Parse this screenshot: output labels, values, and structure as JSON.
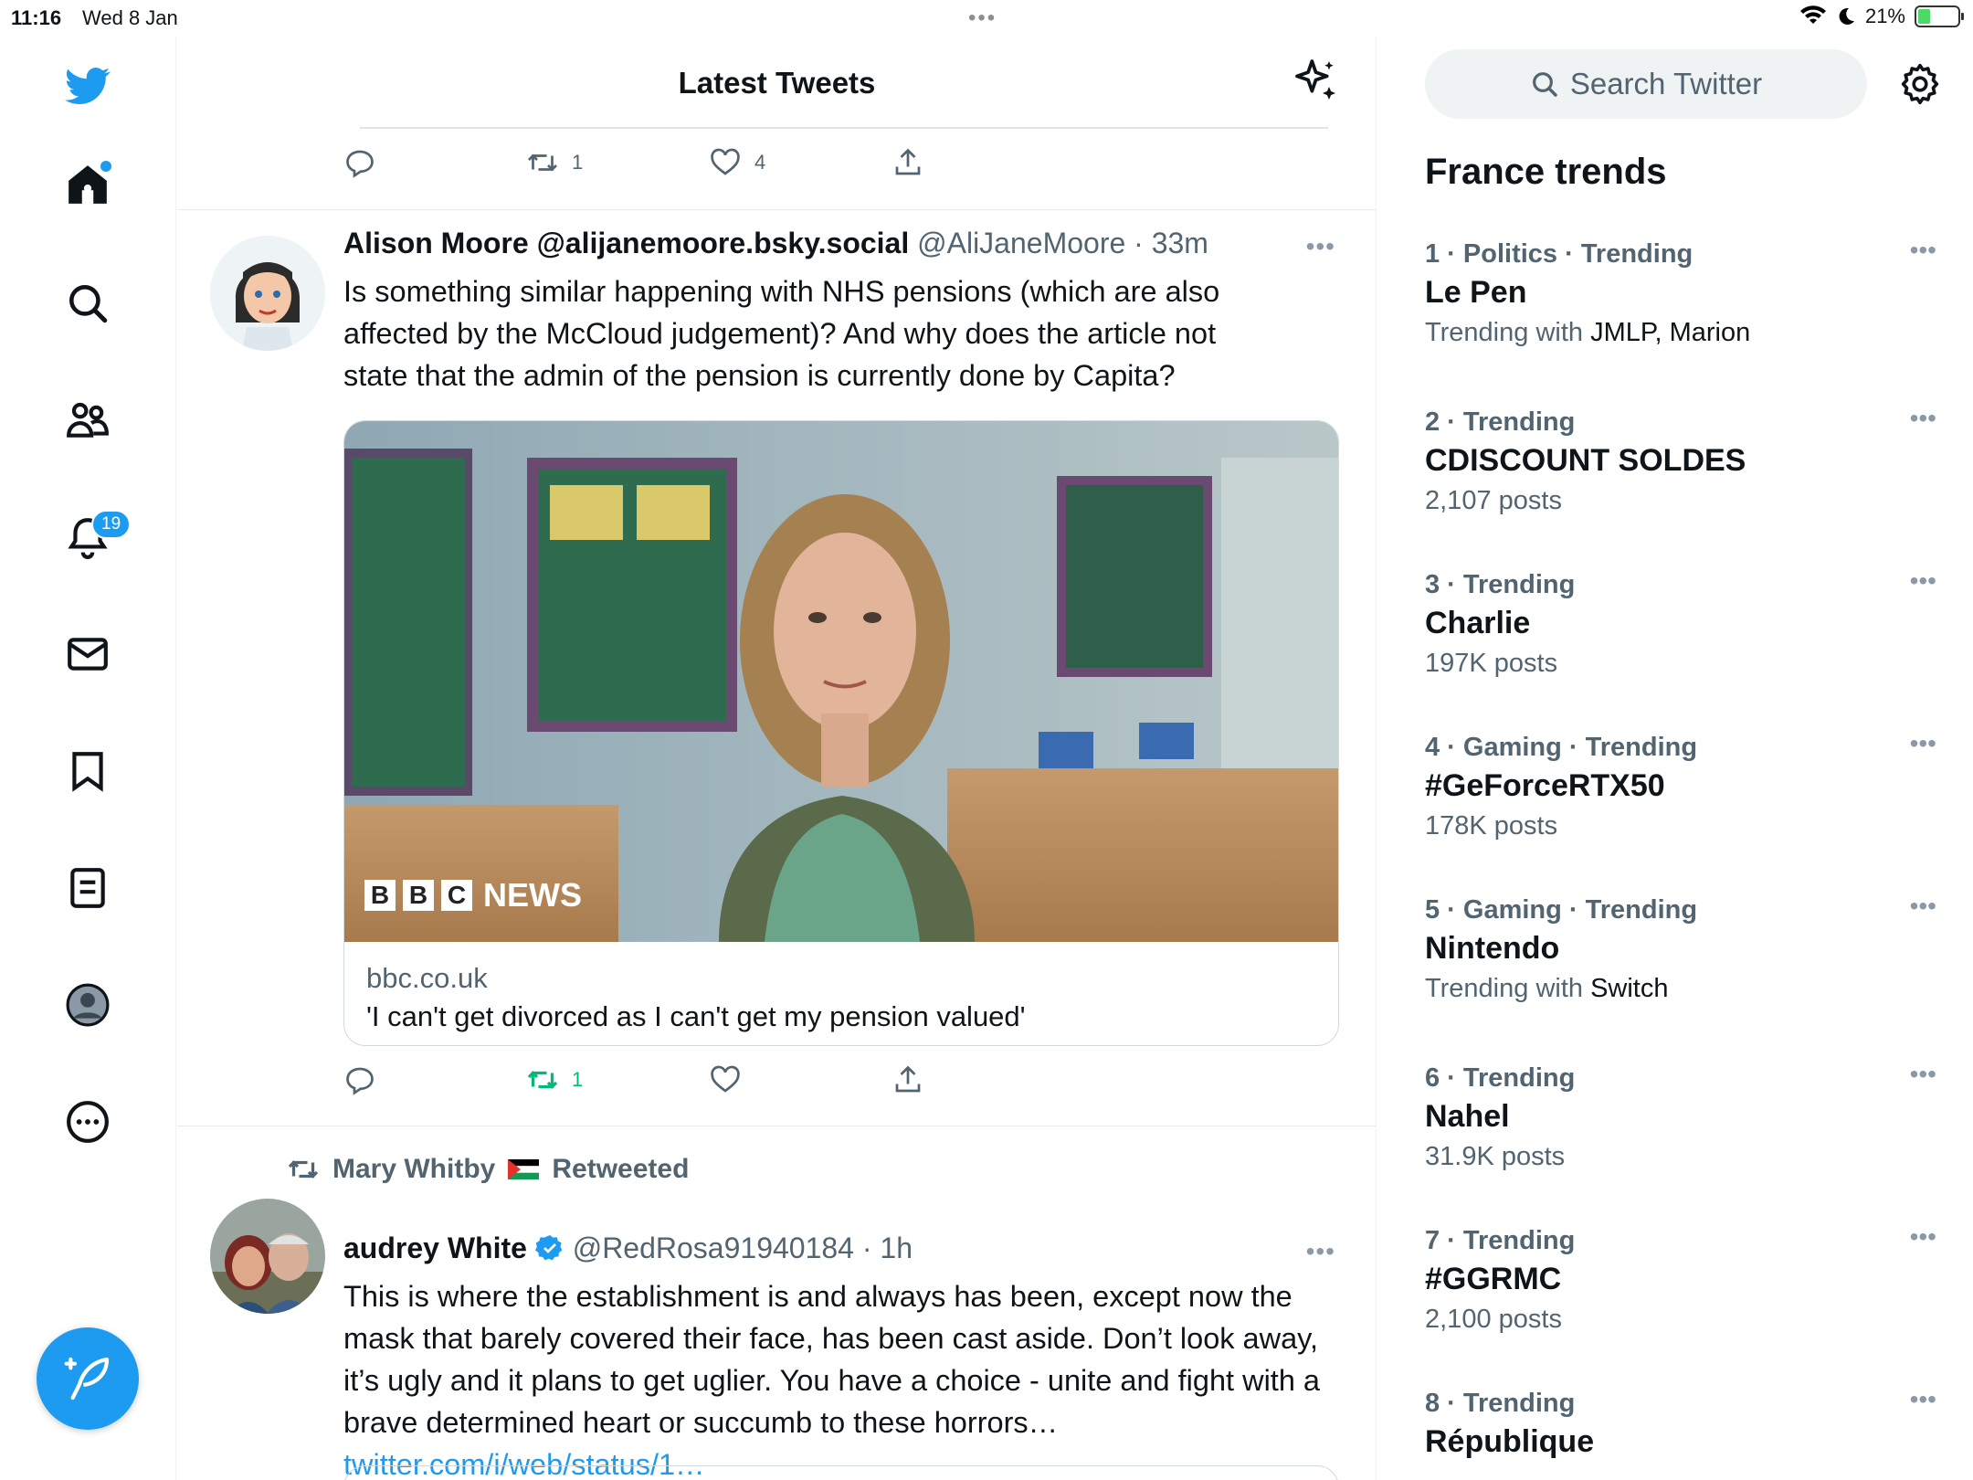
{
  "status_bar": {
    "time": "11:16",
    "date": "Wed 8 Jan",
    "battery": "21%"
  },
  "main": {
    "title": "Latest Tweets",
    "prev_tweet_actions": {
      "retweets": "1",
      "likes": "4"
    }
  },
  "nav": {
    "notifications_badge": "19"
  },
  "tweet1": {
    "name": "Alison Moore @alijanemoore.bsky.social",
    "handle_time": "@AliJaneMoore · 33m",
    "text": "Is something similar happening with NHS pensions (which are also affected by the McCloud judgement)? And why does the article not state that the admin of the pension is currently done by Capita?",
    "card": {
      "domain": "bbc.co.uk",
      "title": "'I can't get divorced as I can't get my pension valued'",
      "logo_blocks": [
        "B",
        "B",
        "C"
      ],
      "logo_word": "NEWS"
    },
    "retweets": "1"
  },
  "tweet2": {
    "retweeted_by": "Mary Whitby",
    "retweeted_label": "Retweeted",
    "name": "audrey White",
    "handle_time": "@RedRosa91940184 · 1h",
    "text": "This is where the establishment is and  always has been, except now the mask that barely covered their face, has been cast aside. Don’t look away, it’s ugly and it plans to get uglier. You have a choice - unite and fight with a brave determined heart or succumb to these horrors…",
    "link": "twitter.com/i/web/status/1…"
  },
  "sidebar": {
    "search_placeholder": "Search Twitter",
    "trends_title": "France trends",
    "trends": [
      {
        "context": "1 · Politics · Trending",
        "topic": "Le Pen",
        "sub_prefix": "Trending with ",
        "sub_value": "JMLP, Marion"
      },
      {
        "context": "2 · Trending",
        "topic": "CDISCOUNT SOLDES",
        "sub_prefix": "2,107 posts",
        "sub_value": ""
      },
      {
        "context": "3 · Trending",
        "topic": "Charlie",
        "sub_prefix": "197K posts",
        "sub_value": ""
      },
      {
        "context": "4 · Gaming · Trending",
        "topic": "#GeForceRTX50",
        "sub_prefix": "178K posts",
        "sub_value": ""
      },
      {
        "context": "5 · Gaming · Trending",
        "topic": "Nintendo",
        "sub_prefix": "Trending with ",
        "sub_value": "Switch"
      },
      {
        "context": "6 · Trending",
        "topic": "Nahel",
        "sub_prefix": "31.9K posts",
        "sub_value": ""
      },
      {
        "context": "7 · Trending",
        "topic": "#GGRMC",
        "sub_prefix": "2,100 posts",
        "sub_value": ""
      },
      {
        "context": "8 · Trending",
        "topic": "République",
        "sub_prefix": "",
        "sub_value": ""
      }
    ]
  },
  "colors": {
    "accent": "#1d9bf0",
    "retweet_green": "#00ba7c",
    "muted": "#536471"
  }
}
